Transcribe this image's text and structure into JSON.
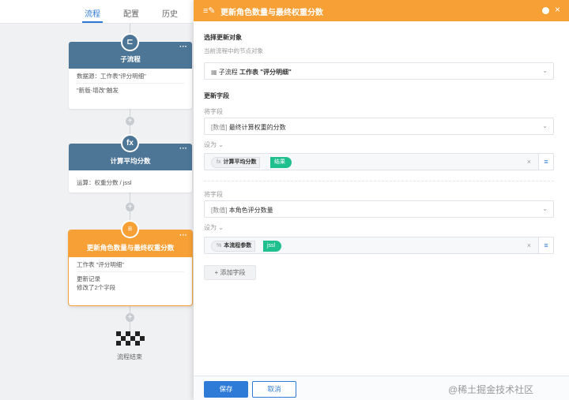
{
  "tabs": [
    {
      "label": "流程"
    },
    {
      "label": "配置"
    },
    {
      "label": "历史"
    }
  ],
  "nodes": {
    "subflow": {
      "title": "子流程",
      "line1": "数据源：工作表\"评分明细\"",
      "line2": "\"新版-增改\"触发"
    },
    "calc": {
      "title": "计算平均分数",
      "line1": "运算：权重分数 / jssl"
    },
    "update": {
      "title": "更新角色数量与最终权重分数",
      "line1": "工作表 \"评分明细\"",
      "line2": "更新记录",
      "line3": "修改了2个字段"
    },
    "end": {
      "label": "流程结束"
    }
  },
  "panel": {
    "title": "更新角色数量与最终权重分数",
    "select_target_label": "选择更新对象",
    "select_target_hint": "当前流程中的节点对象",
    "target_value_prefix": "子流程",
    "target_value": "工作表 \"评分明细\"",
    "update_fields_label": "更新字段",
    "fields": [
      {
        "field_label": "将字段",
        "type_tag": "[数值]",
        "field_name": "最终计算权重的分数",
        "set_label": "设为",
        "chip_icon": "fx",
        "chip_name": "计算平均分数",
        "chip_tail": "结果"
      },
      {
        "field_label": "将字段",
        "type_tag": "[数值]",
        "field_name": "本角色评分数量",
        "set_label": "设为",
        "chip_icon": "%",
        "chip_name": "本流程参数",
        "chip_tail": "jssl"
      }
    ],
    "add_field": "+ 添加字段",
    "save": "保存",
    "cancel": "取消"
  },
  "watermark": "@稀土掘金技术社区",
  "colors": {
    "accent_blue": "#2d7bd6",
    "node_blue": "#4d7596",
    "node_orange": "#f6a036",
    "chip_green": "#1fbf8e"
  }
}
